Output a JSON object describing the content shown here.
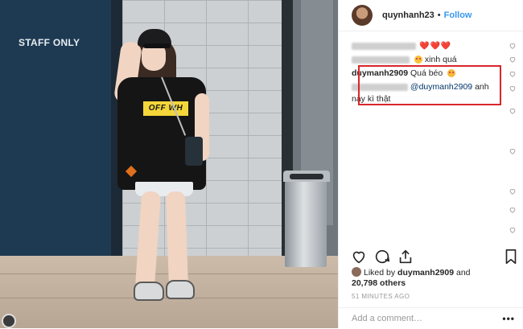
{
  "photo": {
    "wall_sign": "STAFF ONLY",
    "shirt_print": "OFF WH"
  },
  "header": {
    "username": "quynhanh23",
    "separator": "•",
    "follow_label": "Follow"
  },
  "comments": [
    {
      "user": "",
      "text": "❤️❤️❤️",
      "redacted": true
    },
    {
      "user": "",
      "text": "xinh quá",
      "redacted": true
    },
    {
      "user": "duymanh2909",
      "text": "Quá béo"
    },
    {
      "user": "",
      "mention": "@duymanh2909",
      "text": "anh này kì thật",
      "redacted": true
    }
  ],
  "stats": {
    "likes_prefix": "Liked by",
    "liked_by_user": "duymanh2909",
    "likes_and": "and",
    "likes_count": "20,798 others",
    "timestamp": "51 MINUTES AGO"
  },
  "add_comment": {
    "placeholder": "Add a comment…",
    "more": "•••"
  },
  "icons": {
    "like": "heart-icon",
    "comment": "comment-icon",
    "share": "share-icon",
    "save": "bookmark-icon"
  },
  "colors": {
    "link": "#3897f0",
    "highlight_box": "#d9262b",
    "heart": "#e0245e"
  }
}
